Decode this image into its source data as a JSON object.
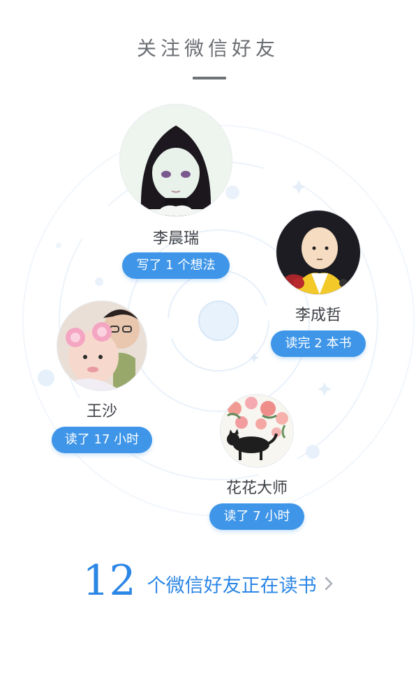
{
  "header": {
    "title": "关注微信好友"
  },
  "friends": [
    {
      "name": "李晨瑞",
      "badge": "写了 1 个想法",
      "avatar_icon": "anime-girl-avatar"
    },
    {
      "name": "李成哲",
      "badge": "读完 2 本书",
      "avatar_icon": "bald-hero-avatar"
    },
    {
      "name": "王沙",
      "badge": "读了 17 小时",
      "avatar_icon": "baby-photo-avatar"
    },
    {
      "name": "花花大师",
      "badge": "读了 7 小时",
      "avatar_icon": "cat-flowers-avatar"
    }
  ],
  "footer": {
    "count": "12",
    "text": "个微信好友正在读书",
    "chevron_icon": "chevron-right-icon"
  },
  "colors": {
    "accent": "#2b86e6",
    "badge_bg": "#3f96e8",
    "title": "#6b6e73"
  }
}
